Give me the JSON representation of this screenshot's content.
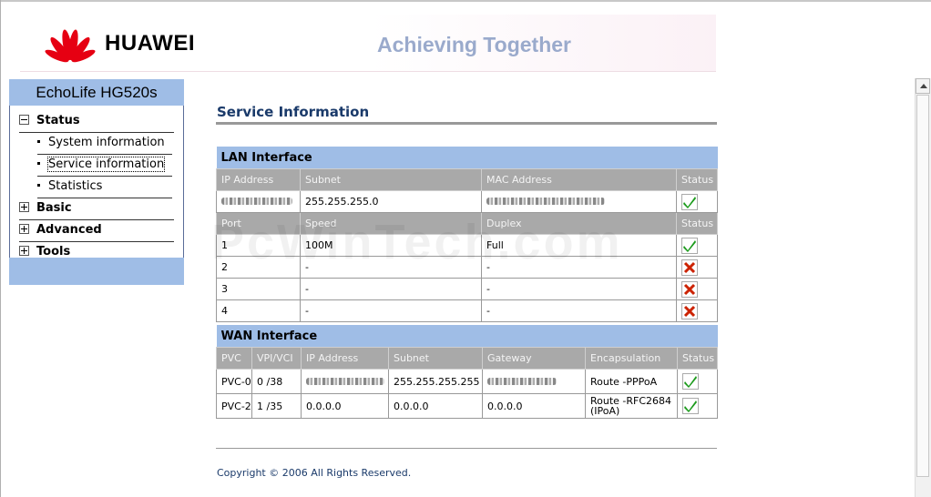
{
  "header": {
    "brand": "HUAWEI",
    "tagline": "Achieving Together",
    "brand_color": "#e60012"
  },
  "sidebar": {
    "title": "EchoLife HG520s",
    "items": [
      {
        "label": "Status",
        "icon": "collapse-icon"
      },
      {
        "label": "Basic",
        "icon": "expand-icon"
      },
      {
        "label": "Advanced",
        "icon": "expand-icon"
      },
      {
        "label": "Tools",
        "icon": "expand-icon"
      }
    ],
    "status_subitems": [
      {
        "label": "System information"
      },
      {
        "label": "Service information",
        "selected": true
      },
      {
        "label": "Statistics"
      }
    ]
  },
  "content": {
    "title": "Service Information",
    "lan": {
      "section_title": "LAN Interface",
      "headers": [
        "IP Address",
        "Subnet",
        "MAC Address",
        "Status"
      ],
      "row": {
        "subnet": "255.255.255.0"
      },
      "port_headers": [
        "Port",
        "Speed",
        "Duplex",
        "Status"
      ],
      "ports": [
        {
          "port": "1",
          "speed": "100M",
          "duplex": "Full",
          "status": "ok"
        },
        {
          "port": "2",
          "speed": "-",
          "duplex": "-",
          "status": "down"
        },
        {
          "port": "3",
          "speed": "-",
          "duplex": "-",
          "status": "down"
        },
        {
          "port": "4",
          "speed": "-",
          "duplex": "-",
          "status": "down"
        }
      ]
    },
    "wan": {
      "section_title": "WAN Interface",
      "headers": [
        "PVC",
        "VPI/VCI",
        "IP Address",
        "Subnet",
        "Gateway",
        "Encapsulation",
        "Status"
      ],
      "rows": [
        {
          "pvc": "PVC-0",
          "vpivci": "0 /38",
          "ip": "",
          "subnet": "255.255.255.255",
          "gateway": "",
          "encap": "Route -PPPoA",
          "status": "ok"
        },
        {
          "pvc": "PVC-2",
          "vpivci": "1 /35",
          "ip": "0.0.0.0",
          "subnet": "0.0.0.0",
          "gateway": "0.0.0.0",
          "encap": "Route -RFC2684 (IPoA)",
          "status": "ok"
        }
      ]
    },
    "copyright": "Copyright © 2006 All Rights Reserved."
  },
  "watermark": "PcWinTech.com",
  "colors": {
    "nav_blue": "#9fbde6",
    "header_gray": "#a9a9a9",
    "title_blue": "#1a3a6a",
    "ok_green": "#1a9a1a",
    "error_red": "#cc2200"
  }
}
